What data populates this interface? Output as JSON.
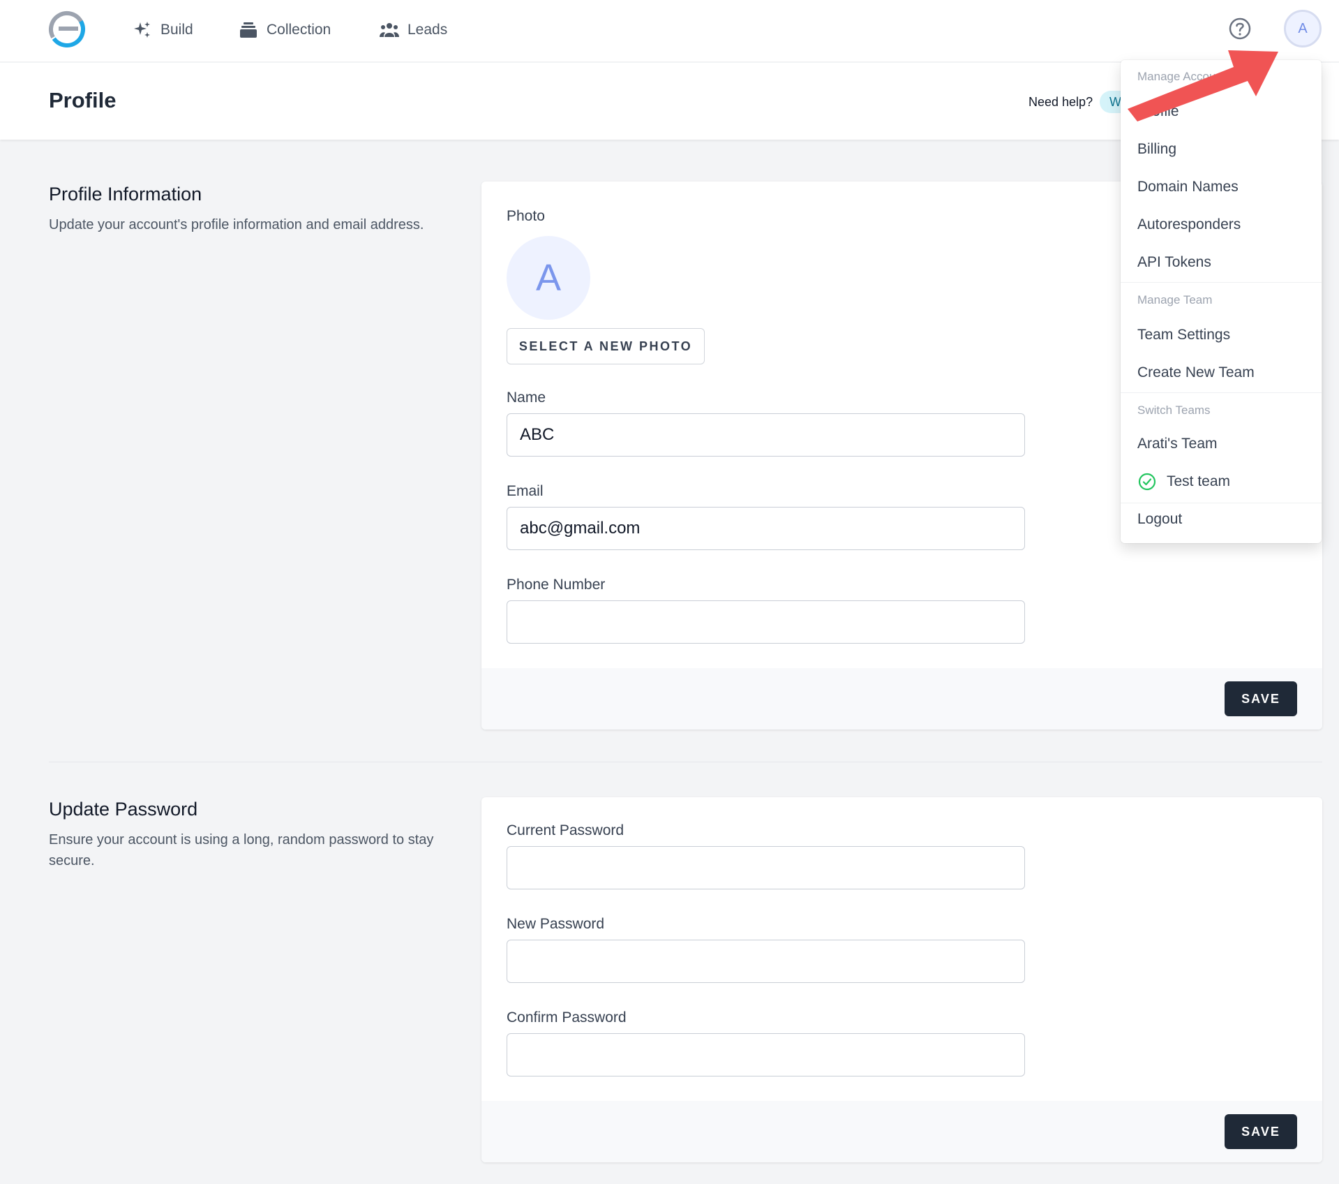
{
  "nav": {
    "items": [
      {
        "label": "Build",
        "icon": "sparkles-icon"
      },
      {
        "label": "Collection",
        "icon": "stack-icon"
      },
      {
        "label": "Leads",
        "icon": "users-icon"
      }
    ],
    "avatar_initial": "A"
  },
  "header": {
    "title": "Profile",
    "need_help": "Need help?",
    "help_pill": "W"
  },
  "profile_section": {
    "title": "Profile Information",
    "description": "Update your account's profile information and email address.",
    "photo_label": "Photo",
    "photo_initial": "A",
    "select_photo": "SELECT A NEW PHOTO",
    "name_label": "Name",
    "name_value": "ABC",
    "email_label": "Email",
    "email_value": "abc@gmail.com",
    "phone_label": "Phone Number",
    "phone_value": "",
    "save": "SAVE"
  },
  "password_section": {
    "title": "Update Password",
    "description": "Ensure your account is using a long, random password to stay secure.",
    "current_label": "Current Password",
    "new_label": "New Password",
    "confirm_label": "Confirm Password",
    "save": "SAVE"
  },
  "dropdown": {
    "manage_account": "Manage Account",
    "profile": "Profile",
    "billing": "Billing",
    "domain_names": "Domain Names",
    "autoresponders": "Autoresponders",
    "api_tokens": "API Tokens",
    "manage_team": "Manage Team",
    "team_settings": "Team Settings",
    "create_team": "Create New Team",
    "switch_teams": "Switch Teams",
    "team_1": "Arati's Team",
    "team_2": "Test team",
    "logout": "Logout"
  },
  "colors": {
    "arrow": "#f05454",
    "check": "#22c55e",
    "primary_button": "#1f2937"
  }
}
